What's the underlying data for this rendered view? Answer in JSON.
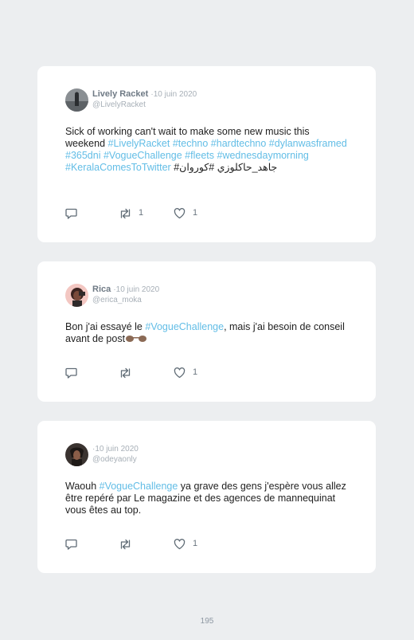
{
  "tweets": [
    {
      "author": "Lively Racket",
      "separator": "·",
      "date": "10 juin 2020",
      "handle": "@LivelyRacket",
      "text": [
        "Sick of working can't wait to make some new music this weekend ",
        "#LivelyRacket",
        " ",
        "#techno",
        " ",
        "#hardtechno",
        " ",
        "#dylanwasframed",
        " ",
        "#365dni",
        " ",
        "#VogueChallenge",
        " ",
        "#fleets",
        " ",
        "#wednesdaymorning",
        " ",
        "#KeralaComesToTwitter",
        " ",
        "#جاهد_حاكلوزي #كوروان",
        ""
      ],
      "reply_icon": "reply-icon",
      "retweet_count": "1",
      "like_count": "1"
    },
    {
      "author": "Rica",
      "separator": "·",
      "date": "10 juin 2020",
      "handle": "@erica_moka",
      "text": [
        "Bon j'ai essayé le ",
        "#VogueChallenge",
        ", mais j'ai besoin de conseil avant de post",
        "🕶",
        ""
      ],
      "retweet_count": "",
      "like_count": "1"
    },
    {
      "author": "",
      "separator": "·",
      "date": "10 juin 2020",
      "handle": "@odeyaonly",
      "text": [
        "Waouh ",
        "#VogueChallenge",
        " ya grave des gens j'espère vous allez être repéré par Le magazine et des agences de mannequinat vous êtes au top."
      ],
      "retweet_count": "",
      "like_count": "1"
    }
  ],
  "page_number": "195",
  "colors": {
    "background": "#eceef0",
    "card": "#ffffff",
    "hashtag": "#62bde6",
    "meta": "#a7afb7",
    "name": "#6f7a85"
  }
}
